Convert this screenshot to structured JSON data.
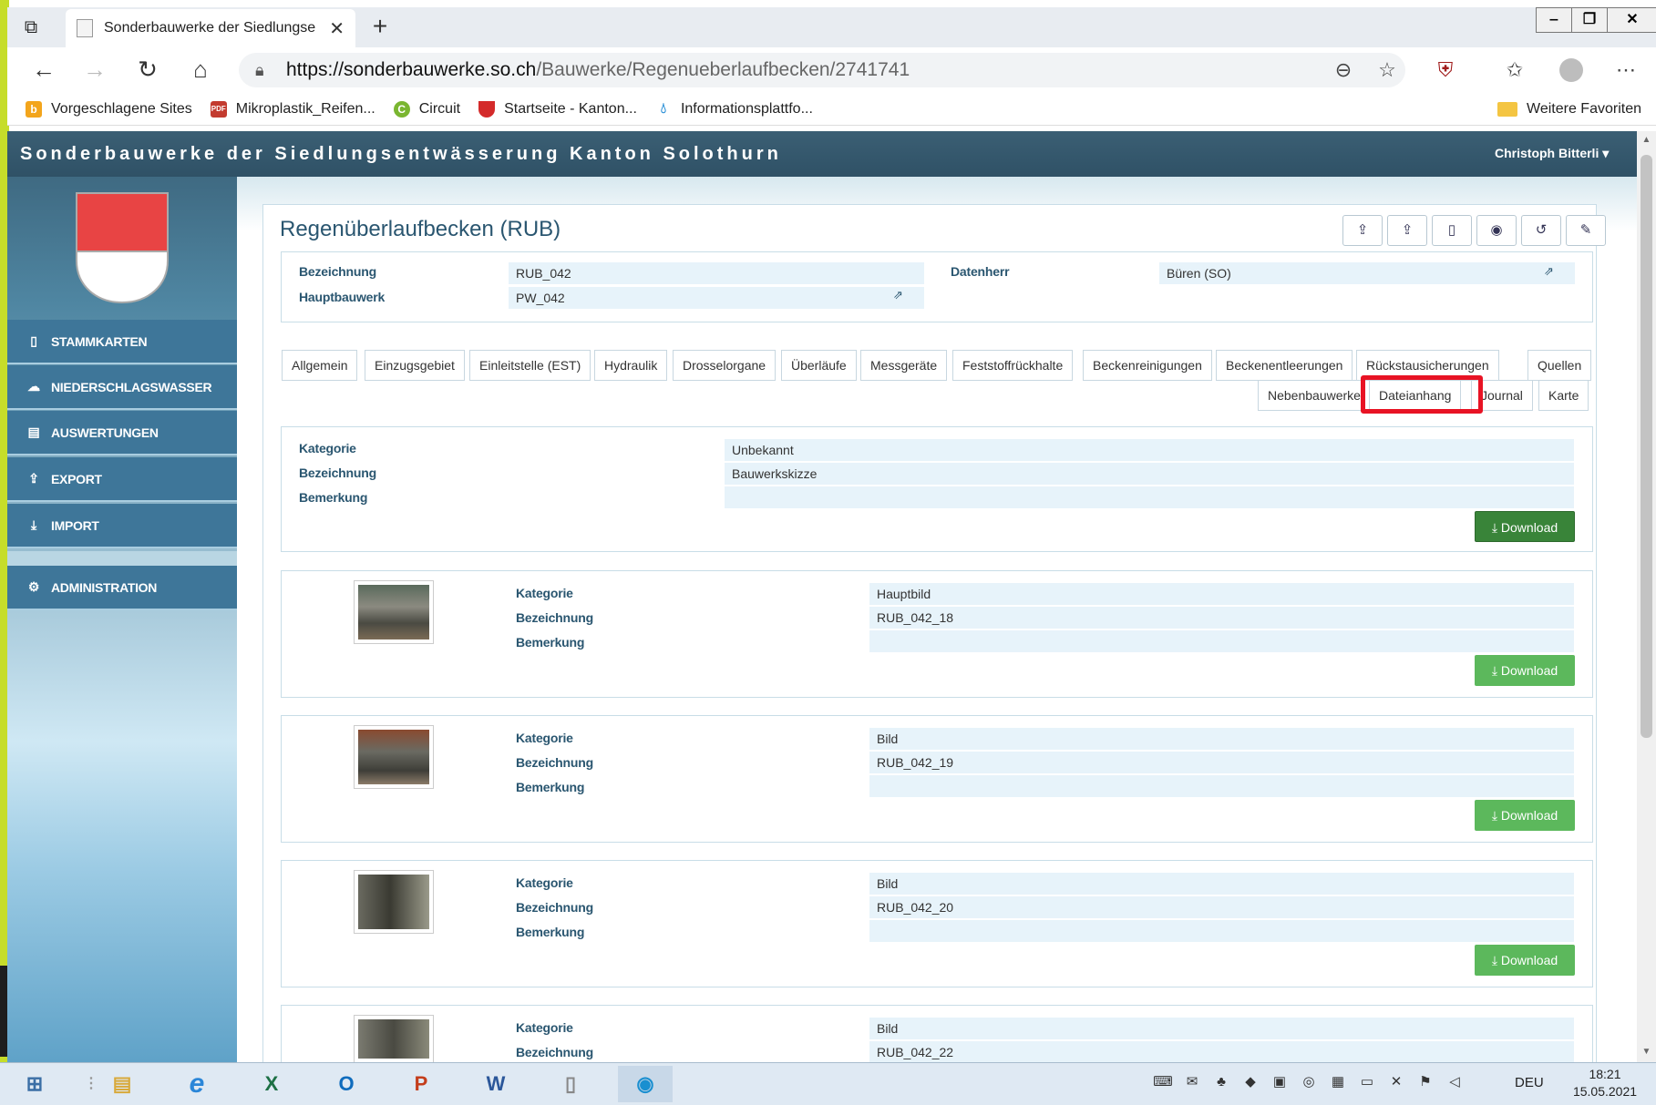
{
  "browser": {
    "tab_title": "Sonderbauwerke der Siedlungse",
    "url_host": "https://sonderbauwerke.so.ch",
    "url_path": "/Bauwerke/Regenueberlaufbecken/2741741",
    "bookmarks": [
      {
        "label": "Vorgeschlagene Sites",
        "icon": "bing-icon",
        "color": "#f3a51c"
      },
      {
        "label": "Mikroplastik_Reifen...",
        "icon": "pdf-icon",
        "color": "#c33b2f"
      },
      {
        "label": "Circuit",
        "icon": "circuit-icon",
        "color": "#7ab631"
      },
      {
        "label": "Startseite - Kanton...",
        "icon": "solothurn-shield-icon",
        "color": "#d42a2a"
      },
      {
        "label": "Informationsplattfo...",
        "icon": "water-drop-icon",
        "color": "#2a8fd6"
      }
    ],
    "bookmarks_more": "Weitere Favoriten"
  },
  "app": {
    "title": "Sonderbauwerke der Siedlungsentwässerung Kanton Solothurn",
    "user": "Christoph Bitterli",
    "sidebar": [
      {
        "label": "STAMMKARTEN",
        "icon": "map-icon"
      },
      {
        "label": "NIEDERSCHLAGSWASSER",
        "icon": "cloud-icon"
      },
      {
        "label": "AUSWERTUNGEN",
        "icon": "document-icon"
      },
      {
        "label": "EXPORT",
        "icon": "upload-icon"
      },
      {
        "label": "IMPORT",
        "icon": "download-icon"
      },
      {
        "label": "ADMINISTRATION",
        "icon": "gear-icon"
      }
    ]
  },
  "page": {
    "title": "Regenüberlaufbecken (RUB)",
    "fields": {
      "bezeichnung_label": "Bezeichnung",
      "bezeichnung_value": "RUB_042",
      "hauptbauwerk_label": "Hauptbauwerk",
      "hauptbauwerk_value": "PW_042",
      "datenherr_label": "Datenherr",
      "datenherr_value": "Büren (SO)"
    },
    "tabs_row1": [
      "Allgemein",
      "Einzugsgebiet",
      "Einleitstelle (EST)",
      "Hydraulik",
      "Drosselorgane",
      "Überläufe",
      "Messgeräte",
      "Feststoffrückhalte",
      "Beckenreinigungen",
      "Beckenentleerungen",
      "Rückstausicherungen",
      "Quellen"
    ],
    "tabs_row2": [
      "Nebenbauwerke",
      "Dateianhang",
      "Journal",
      "Karte"
    ],
    "active_tab": "Dateianhang",
    "labels": {
      "kategorie": "Kategorie",
      "bezeichnung": "Bezeichnung",
      "bemerkung": "Bemerkung",
      "download": "Download"
    },
    "files": [
      {
        "kategorie": "Unbekannt",
        "bezeichnung": "Bauwerkskizze",
        "bemerkung": ""
      },
      {
        "kategorie": "Hauptbild",
        "bezeichnung": "RUB_042_18",
        "bemerkung": ""
      },
      {
        "kategorie": "Bild",
        "bezeichnung": "RUB_042_19",
        "bemerkung": ""
      },
      {
        "kategorie": "Bild",
        "bezeichnung": "RUB_042_20",
        "bemerkung": ""
      },
      {
        "kategorie": "Bild",
        "bezeichnung": "RUB_042_22",
        "bemerkung": ""
      }
    ]
  },
  "taskbar": {
    "lang": "DEU",
    "time": "18:21",
    "date": "15.05.2021",
    "apps": [
      {
        "name": "explorer-icon",
        "glyph": "▤",
        "color": "#d8a93a"
      },
      {
        "name": "internet-explorer-icon",
        "glyph": "e",
        "color": "#2a86d8"
      },
      {
        "name": "excel-icon",
        "glyph": "X",
        "color": "#1d7044"
      },
      {
        "name": "outlook-icon",
        "glyph": "O",
        "color": "#0f6cbd"
      },
      {
        "name": "powerpoint-icon",
        "glyph": "P",
        "color": "#c43e1c"
      },
      {
        "name": "word-icon",
        "glyph": "W",
        "color": "#2b579a"
      },
      {
        "name": "file-icon",
        "glyph": "▯",
        "color": "#888888"
      },
      {
        "name": "edge-icon",
        "glyph": "◉",
        "color": "#1a8fd0"
      }
    ]
  }
}
